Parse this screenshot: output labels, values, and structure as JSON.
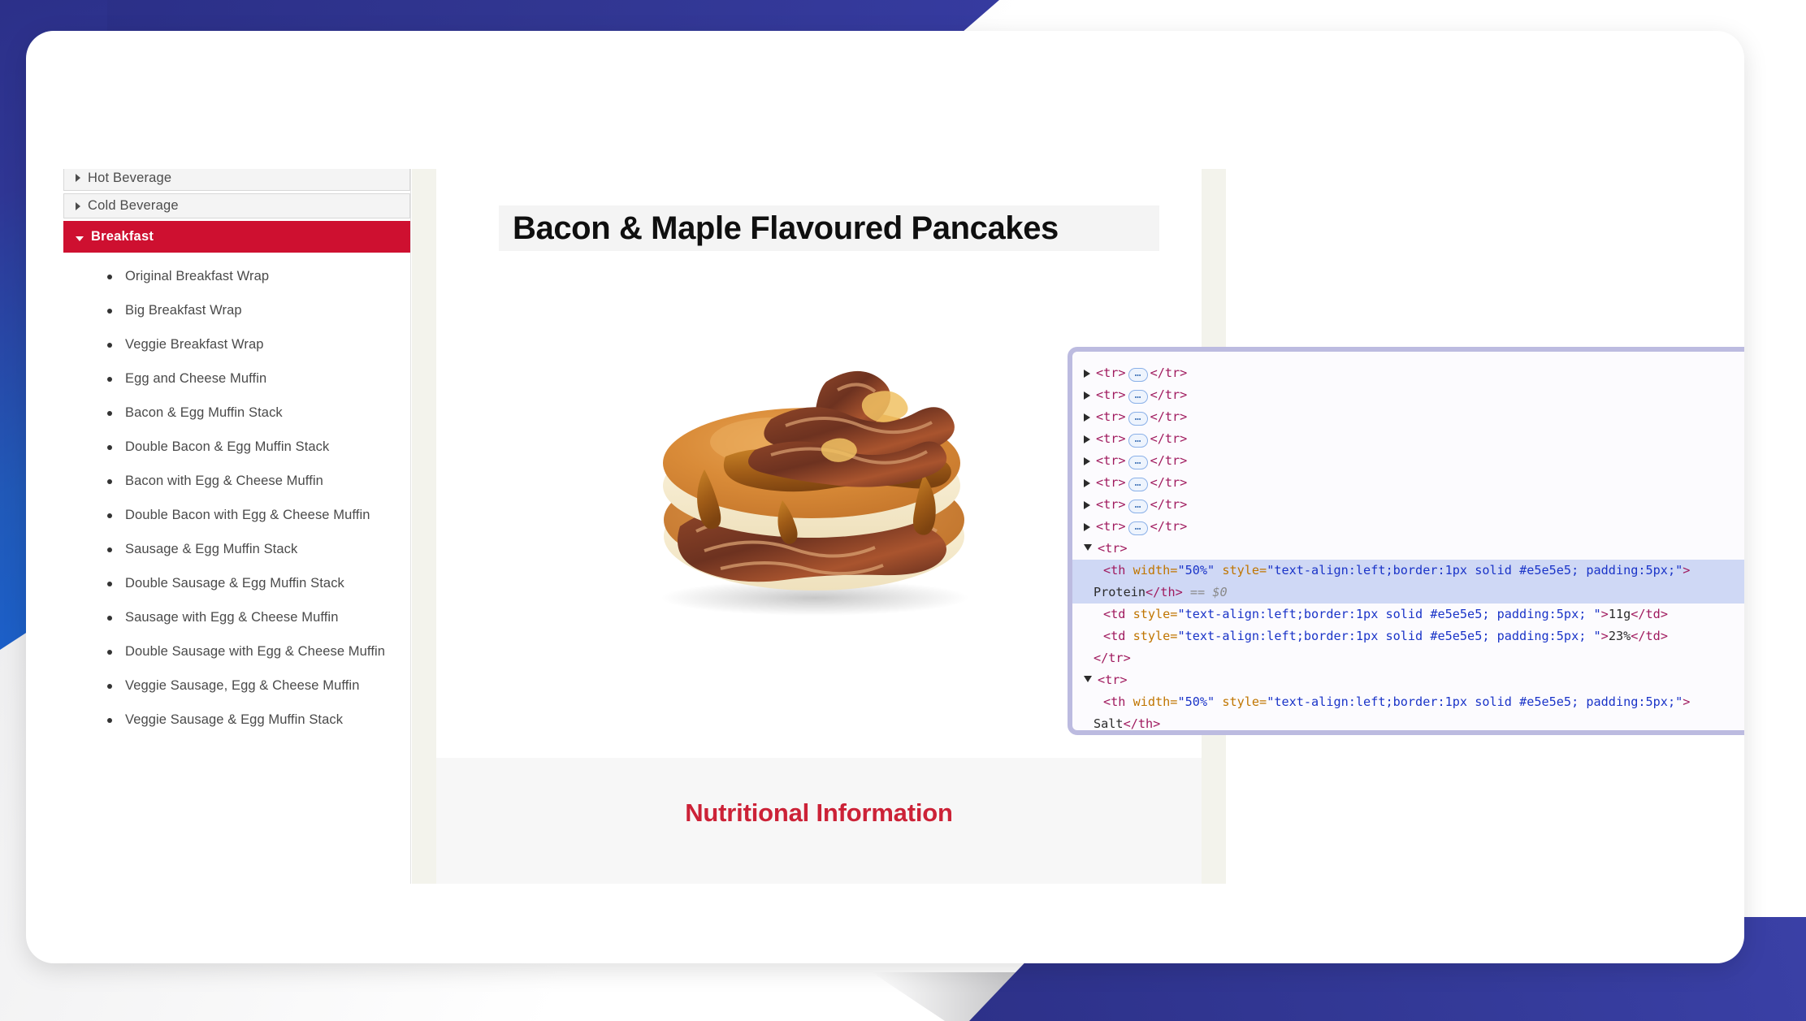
{
  "sidebar": {
    "accordion": [
      {
        "label": "Hot Beverage",
        "state": "collapsed",
        "icon": "triangle-right-icon"
      },
      {
        "label": "Cold Beverage",
        "state": "collapsed",
        "icon": "triangle-right-icon"
      },
      {
        "label": "Breakfast",
        "state": "expanded",
        "icon": "triangle-down-icon",
        "active": true
      }
    ],
    "items": [
      "Original Breakfast Wrap",
      "Big Breakfast Wrap",
      "Veggie Breakfast Wrap",
      "Egg and Cheese Muffin",
      "Bacon & Egg Muffin Stack",
      "Double Bacon & Egg Muffin Stack",
      "Bacon with Egg & Cheese Muffin",
      "Double Bacon with Egg & Cheese Muffin",
      "Sausage & Egg Muffin Stack",
      "Double Sausage & Egg Muffin Stack",
      "Sausage with Egg & Cheese Muffin",
      "Double Sausage with Egg & Cheese Muffin",
      "Veggie Sausage, Egg & Cheese Muffin",
      "Veggie Sausage & Egg Muffin Stack"
    ],
    "active_color": "#ce1030"
  },
  "main": {
    "product_title": "Bacon & Maple Flavoured Pancakes",
    "product_image_alt": "stack of two pancakes topped with bacon and maple syrup",
    "nutritional_heading": "Nutritional Information",
    "heading_color": "#cc2237"
  },
  "devtools": {
    "collapsed_rows": [
      {
        "open": "<tr>",
        "ellipsis": "…",
        "close": "</tr>"
      },
      {
        "open": "<tr>",
        "ellipsis": "…",
        "close": "</tr>"
      },
      {
        "open": "<tr>",
        "ellipsis": "…",
        "close": "</tr>"
      },
      {
        "open": "<tr>",
        "ellipsis": "…",
        "close": "</tr>"
      },
      {
        "open": "<tr>",
        "ellipsis": "…",
        "close": "</tr>"
      },
      {
        "open": "<tr>",
        "ellipsis": "…",
        "close": "</tr>"
      },
      {
        "open": "<tr>",
        "ellipsis": "…",
        "close": "</tr>"
      },
      {
        "open": "<tr>",
        "ellipsis": "…",
        "close": "</tr>"
      }
    ],
    "expanded": {
      "row1_open": "<tr>",
      "th_tag_open": "<th ",
      "th_attr_width": "width=",
      "th_attr_width_val": "\"50%\"",
      "th_attr_style": " style=",
      "th_attr_style_val": "\"text-align:left;border:1px solid #e5e5e5; padding:5px;\"",
      "th_close_bracket": ">",
      "th_text": "Protein",
      "th_tag_close": "</th>",
      "selection_ref": "== $0",
      "td1_open": "<td ",
      "td1_attr_style": "style=",
      "td1_attr_style_val": "\"text-align:left;border:1px solid #e5e5e5; padding:5px; \"",
      "td1_bracket": ">",
      "td1_text": "11g",
      "td1_close": "</td>",
      "td2_open": "<td ",
      "td2_attr_style": "style=",
      "td2_attr_style_val": "\"text-align:left;border:1px solid #e5e5e5; padding:5px; \"",
      "td2_bracket": ">",
      "td2_text": "23%",
      "td2_close": "</td>",
      "row1_close": "</tr>",
      "row2_open": "<tr>",
      "th2_tag_open": "<th ",
      "th2_attr_width": "width=",
      "th2_attr_width_val": "\"50%\"",
      "th2_attr_style": " style=",
      "th2_attr_style_val": "\"text-align:left;border:1px solid #e5e5e5; padding:5px;\"",
      "th2_close_bracket": ">",
      "th2_text": "Salt",
      "th2_tag_close": "</th>"
    },
    "selection_highlight_color": "#cfd8f5",
    "border_color": "#bcbbe0"
  },
  "decor": {
    "navy": "#2f3491",
    "blue": "#1b61cc"
  }
}
